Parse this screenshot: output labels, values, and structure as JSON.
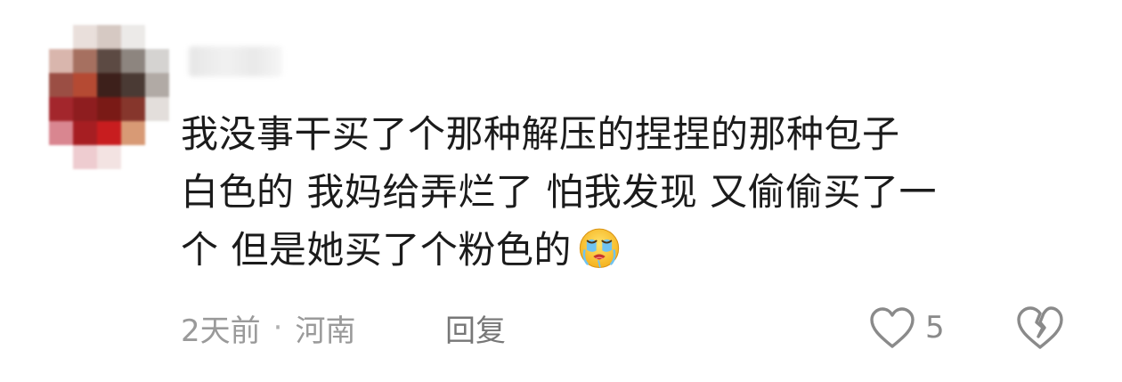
{
  "comment": {
    "lines": [
      "我没事干买了个那种解压的捏捏的那种包子",
      "白色的 我妈给弄烂了 怕我发现 又偷偷买了一",
      "个 但是她买了个粉色的"
    ],
    "emoji": "crying-face-emoji"
  },
  "meta": {
    "time": "2天前",
    "separator": "·",
    "location": "河南"
  },
  "actions": {
    "reply_label": "回复",
    "like_count": "5"
  },
  "colors": {
    "text": "#1b1b1b",
    "meta": "#9a9a9a",
    "icon": "#8a8a8a"
  }
}
